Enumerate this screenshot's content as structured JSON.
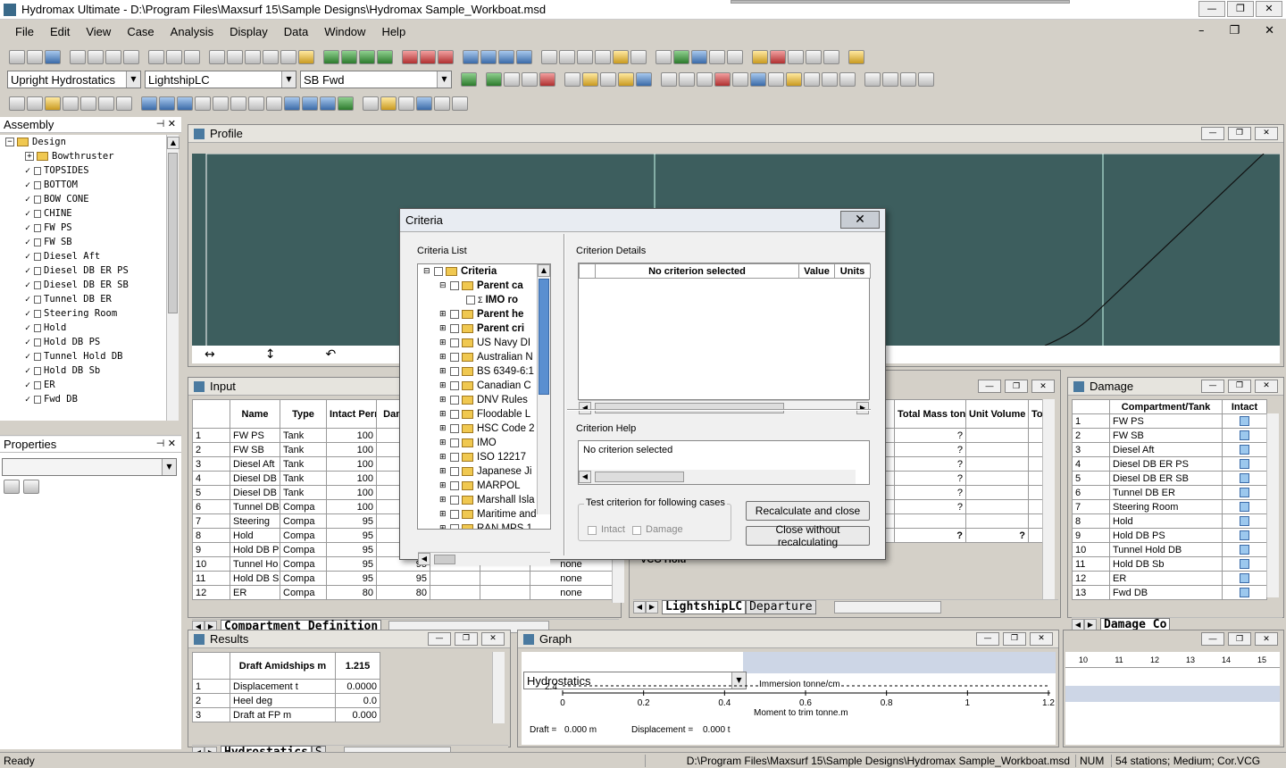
{
  "window": {
    "title": "Hydromax Ultimate - D:\\Program Files\\Maxsurf 15\\Sample Designs\\Hydromax Sample_Workboat.msd"
  },
  "menu": [
    "File",
    "Edit",
    "View",
    "Case",
    "Analysis",
    "Display",
    "Data",
    "Window",
    "Help"
  ],
  "toolbar": {
    "analysis_combo": "Upright Hydrostatics",
    "loadcase_combo": "LightshipLC",
    "tank_combo": "SB Fwd"
  },
  "assembly": {
    "title": "Assembly",
    "items": [
      {
        "label": "Design",
        "level": 0,
        "type": "folder",
        "check": ""
      },
      {
        "label": "Bowthruster",
        "level": 1,
        "type": "folder",
        "check": "plus"
      },
      {
        "label": "TOPSIDES",
        "level": 1,
        "type": "item",
        "check": "check"
      },
      {
        "label": "BOTTOM",
        "level": 1,
        "type": "item",
        "check": "check"
      },
      {
        "label": "BOW CONE",
        "level": 1,
        "type": "item",
        "check": "check"
      },
      {
        "label": "CHINE",
        "level": 1,
        "type": "item",
        "check": "check"
      },
      {
        "label": "FW PS",
        "level": 1,
        "type": "item",
        "check": "check"
      },
      {
        "label": "FW SB",
        "level": 1,
        "type": "item",
        "check": "check"
      },
      {
        "label": "Diesel Aft",
        "level": 1,
        "type": "item",
        "check": "check"
      },
      {
        "label": "Diesel DB ER PS",
        "level": 1,
        "type": "item",
        "check": "check"
      },
      {
        "label": "Diesel DB ER SB",
        "level": 1,
        "type": "item",
        "check": "check"
      },
      {
        "label": "Tunnel DB ER",
        "level": 1,
        "type": "item",
        "check": "check"
      },
      {
        "label": "Steering Room",
        "level": 1,
        "type": "item",
        "check": "check"
      },
      {
        "label": "Hold",
        "level": 1,
        "type": "item",
        "check": "check"
      },
      {
        "label": "Hold DB PS",
        "level": 1,
        "type": "item",
        "check": "check"
      },
      {
        "label": "Tunnel Hold DB",
        "level": 1,
        "type": "item",
        "check": "check"
      },
      {
        "label": "Hold DB Sb",
        "level": 1,
        "type": "item",
        "check": "check"
      },
      {
        "label": "ER",
        "level": 1,
        "type": "item",
        "check": "check"
      },
      {
        "label": "Fwd DB",
        "level": 1,
        "type": "item",
        "check": "check"
      }
    ]
  },
  "properties": {
    "title": "Properties"
  },
  "profile": {
    "title": "Profile"
  },
  "input": {
    "title": "Input",
    "headers": [
      "Name",
      "Type",
      "Intact Perm. %",
      "Dam Per"
    ],
    "rows": [
      [
        "1",
        "FW PS",
        "Tank",
        "100",
        "",
        "",
        "",
        ""
      ],
      [
        "2",
        "FW SB",
        "Tank",
        "100",
        "",
        "",
        "",
        ""
      ],
      [
        "3",
        "Diesel Aft",
        "Tank",
        "100",
        "",
        "",
        "",
        ""
      ],
      [
        "4",
        "Diesel DB",
        "Tank",
        "100",
        "",
        "",
        "",
        ""
      ],
      [
        "5",
        "Diesel DB",
        "Tank",
        "100",
        "",
        "",
        "",
        ""
      ],
      [
        "6",
        "Tunnel DB",
        "Compa",
        "100",
        "",
        "",
        "",
        ""
      ],
      [
        "7",
        "Steering",
        "Compa",
        "95",
        "",
        "",
        "",
        ""
      ],
      [
        "8",
        "Hold",
        "Compa",
        "95",
        "",
        "",
        "",
        ""
      ],
      [
        "9",
        "Hold DB P",
        "Compa",
        "95",
        "",
        "",
        "",
        ""
      ],
      [
        "10",
        "Tunnel Ho",
        "Compa",
        "95",
        "95",
        "",
        "",
        "none"
      ],
      [
        "11",
        "Hold DB S",
        "Compa",
        "95",
        "95",
        "",
        "",
        "none"
      ],
      [
        "12",
        "ER",
        "Compa",
        "80",
        "80",
        "",
        "",
        "none"
      ]
    ],
    "tab": "Compartment Definition"
  },
  "loadcase": {
    "headers": [
      "Total Mass tonne",
      "Unit Volume m^3",
      "To"
    ],
    "rows": [
      [
        "?",
        ""
      ],
      [
        "?",
        ""
      ],
      [
        "?",
        ""
      ],
      [
        "?",
        ""
      ],
      [
        "?",
        ""
      ],
      [
        "?",
        ""
      ],
      [
        "",
        ""
      ],
      [
        "?",
        "?"
      ]
    ],
    "last_row_label": "VCG Hold",
    "tabs": [
      "LightshipLC",
      "Departure"
    ]
  },
  "damage": {
    "title": "Damage",
    "headers": [
      "Compartment/Tank",
      "Intact"
    ],
    "rows": [
      [
        "1",
        "FW PS"
      ],
      [
        "2",
        "FW SB"
      ],
      [
        "3",
        "Diesel Aft"
      ],
      [
        "4",
        "Diesel DB ER PS"
      ],
      [
        "5",
        "Diesel DB ER SB"
      ],
      [
        "6",
        "Tunnel DB ER"
      ],
      [
        "7",
        "Steering Room"
      ],
      [
        "8",
        "Hold"
      ],
      [
        "9",
        "Hold DB PS"
      ],
      [
        "10",
        "Tunnel Hold DB"
      ],
      [
        "11",
        "Hold DB Sb"
      ],
      [
        "12",
        "ER"
      ],
      [
        "13",
        "Fwd DB"
      ]
    ],
    "tab": "Damage Co"
  },
  "results": {
    "title": "Results",
    "header": "Draft Amidships m",
    "header_value": "1.215",
    "rows": [
      [
        "1",
        "Displacement t",
        "0.0000"
      ],
      [
        "2",
        "Heel deg",
        "0.0"
      ],
      [
        "3",
        "Draft at FP m",
        "0.000"
      ]
    ],
    "tabs": [
      "Hydrostatics",
      "S"
    ]
  },
  "graph": {
    "title": "Graph",
    "combo": "Hydrostatics",
    "axis_label": "Moment to trim  tonne.m",
    "ticks": [
      "0",
      "0.2",
      "0.4",
      "0.6",
      "0.8",
      "1",
      "1.2"
    ],
    "y_value": "2.4",
    "curve_label": "Immersion  tonne/cm",
    "draft_label": "Draft =",
    "draft_value": "0.000 m",
    "disp_label": "Displacement =",
    "disp_value": "0.000 t"
  },
  "ruler": {
    "ticks": [
      "10",
      "11",
      "12",
      "13",
      "14",
      "15"
    ]
  },
  "criteria_dialog": {
    "title": "Criteria",
    "list_label": "Criteria List",
    "tree": [
      {
        "label": "Criteria",
        "bold": true,
        "level": 0,
        "exp": "minus",
        "folder": true
      },
      {
        "label": "Parent ca",
        "bold": true,
        "level": 1,
        "exp": "minus",
        "folder": true
      },
      {
        "label": "IMO ro",
        "bold": true,
        "level": 2,
        "exp": "",
        "folder": false
      },
      {
        "label": "Parent he",
        "bold": true,
        "level": 1,
        "exp": "plus",
        "folder": true
      },
      {
        "label": "Parent cri",
        "bold": true,
        "level": 1,
        "exp": "plus",
        "folder": true
      },
      {
        "label": "US Navy DI",
        "bold": false,
        "level": 1,
        "exp": "plus",
        "folder": true
      },
      {
        "label": "Australian N",
        "bold": false,
        "level": 1,
        "exp": "plus",
        "folder": true
      },
      {
        "label": "BS 6349-6:1",
        "bold": false,
        "level": 1,
        "exp": "plus",
        "folder": true
      },
      {
        "label": "Canadian C",
        "bold": false,
        "level": 1,
        "exp": "plus",
        "folder": true
      },
      {
        "label": "DNV Rules",
        "bold": false,
        "level": 1,
        "exp": "plus",
        "folder": true
      },
      {
        "label": "Floodable L",
        "bold": false,
        "level": 1,
        "exp": "plus",
        "folder": true
      },
      {
        "label": "HSC Code 2",
        "bold": false,
        "level": 1,
        "exp": "plus",
        "folder": true
      },
      {
        "label": "IMO",
        "bold": false,
        "level": 1,
        "exp": "plus",
        "folder": true
      },
      {
        "label": "ISO 12217",
        "bold": false,
        "level": 1,
        "exp": "plus",
        "folder": true
      },
      {
        "label": "Japanese Ji",
        "bold": false,
        "level": 1,
        "exp": "plus",
        "folder": true
      },
      {
        "label": "MARPOL",
        "bold": false,
        "level": 1,
        "exp": "plus",
        "folder": true
      },
      {
        "label": "Marshall Isla",
        "bold": false,
        "level": 1,
        "exp": "plus",
        "folder": true
      },
      {
        "label": "Maritime and",
        "bold": false,
        "level": 1,
        "exp": "plus",
        "folder": true
      },
      {
        "label": "RAN MPS 1",
        "bold": false,
        "level": 1,
        "exp": "plus",
        "folder": true
      }
    ],
    "details_label": "Criterion Details",
    "details_headers": [
      "No criterion selected",
      "Value",
      "Units"
    ],
    "help_label": "Criterion Help",
    "help_text": "No criterion selected",
    "test_label": "Test criterion for following cases",
    "intact_label": "Intact",
    "damage_label": "Damage",
    "recalc_button": "Recalculate and close",
    "close_button": "Close without recalculating"
  },
  "status": {
    "left": "Ready",
    "path": "D:\\Program Files\\Maxsurf 15\\Sample Designs\\Hydromax Sample_Workboat.msd",
    "num": "NUM",
    "info": "54 stations; Medium; Cor.VCG"
  },
  "colors": {
    "profile_bg": "#3d5e5e",
    "tab_text": "#0a3a5a"
  }
}
